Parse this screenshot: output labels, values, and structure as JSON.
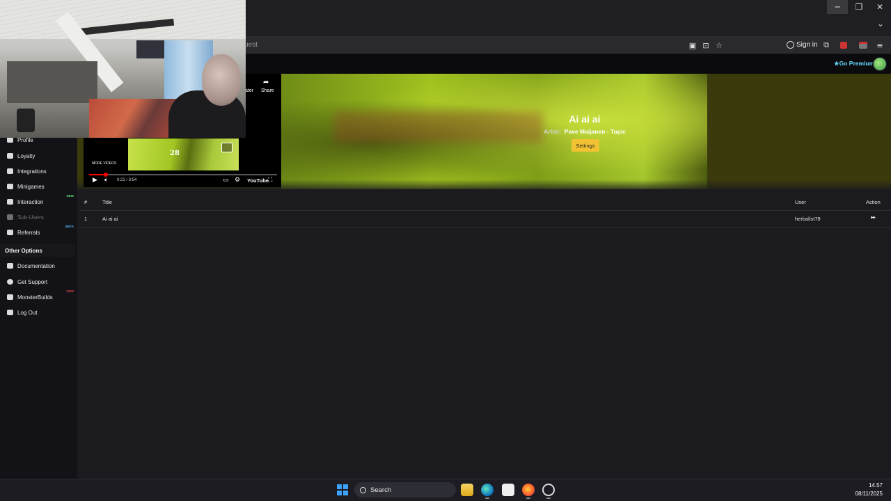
{
  "browser": {
    "address_text": "uest",
    "sign_in_label": "Sign in",
    "window_minimize": "─",
    "window_restore": "❐",
    "window_close": "✕",
    "tab_dropdown": "⌄"
  },
  "header": {
    "go_premium_label": "Go Premium",
    "accent_color": "#68d8ff"
  },
  "sidebar": {
    "items": [
      {
        "label": "Profile",
        "icon": "profile-icon"
      },
      {
        "label": "Loyalty",
        "icon": "trophy-icon"
      },
      {
        "label": "Integrations",
        "icon": "integrations-icon"
      },
      {
        "label": "Minigames",
        "icon": "gamepad-icon"
      },
      {
        "label": "Interaction",
        "icon": "music-note-icon",
        "badge": "NEW"
      },
      {
        "label": "Sub-Users",
        "icon": "users-icon",
        "disabled": true
      },
      {
        "label": "Referrals",
        "icon": "referrals-icon",
        "badge": "BETA"
      }
    ],
    "other_options_heading": "Other Options",
    "other_items": [
      {
        "label": "Documentation",
        "icon": "book-icon"
      },
      {
        "label": "Get Support",
        "icon": "question-icon"
      },
      {
        "label": "MonsterBuilds",
        "icon": "laptop-icon",
        "badge": "NEW"
      },
      {
        "label": "Log Out",
        "icon": "logout-icon"
      }
    ]
  },
  "now_playing": {
    "title": "Ai ai ai",
    "artist_label": "Artist:",
    "artist": "Pave Maijanen - Topic",
    "settings_label": "Settings"
  },
  "player": {
    "share_label": "Share",
    "later_label": "ater",
    "more_videos_label": "MORE VIDEOS",
    "thumb_number": "28",
    "time": "0:21 / 3:54",
    "brand": "YouTube",
    "progress_fraction": 0.09
  },
  "queue": {
    "columns": [
      "#",
      "Title",
      "User",
      "Action"
    ],
    "rows": [
      {
        "num": "1",
        "title": "Ai ai ai",
        "user": "herbalist78",
        "action_icon": "play-next-icon"
      }
    ]
  },
  "taskbar": {
    "search_label": "Search",
    "time": "14.57",
    "date": "08/11/2025"
  }
}
